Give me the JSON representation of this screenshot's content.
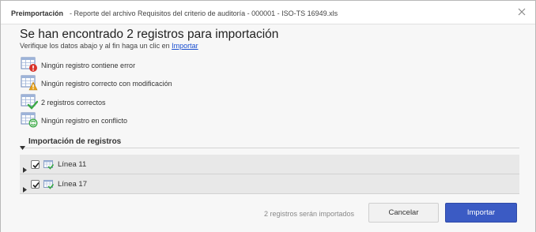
{
  "dialog": {
    "title_bold": "Preimportación",
    "title_rest": "- Reporte del archivo Requisitos del criterio de auditoría - 000001 - ISO-TS 16949.xls",
    "close_icon": "close-icon"
  },
  "heading": "Se han encontrado 2 registros para importación",
  "subheading": {
    "text": "Verifique los datos abajo y al fin haga un clic en",
    "link": "Importar"
  },
  "status": [
    {
      "icon": "table-error-icon",
      "text": "Ningún registro contiene error"
    },
    {
      "icon": "table-warning-icon",
      "text": "Ningún registro correcto con modificación"
    },
    {
      "icon": "table-check-icon",
      "text": "2 registros correctos"
    },
    {
      "icon": "table-conflict-icon",
      "text": "Ningún registro en conflicto"
    }
  ],
  "section": {
    "title": "Importación de registros",
    "rows": [
      {
        "label": "Línea 11",
        "checked": true
      },
      {
        "label": "Línea 17",
        "checked": true
      }
    ]
  },
  "footer": {
    "note": "2 registros serán importados",
    "cancel_label": "Cancelar",
    "import_label": "Importar"
  },
  "colors": {
    "primary_button": "#3b5bc4",
    "link": "#1a4fd1",
    "error": "#d9342b",
    "warning": "#e8a21a",
    "success": "#3aa845"
  }
}
